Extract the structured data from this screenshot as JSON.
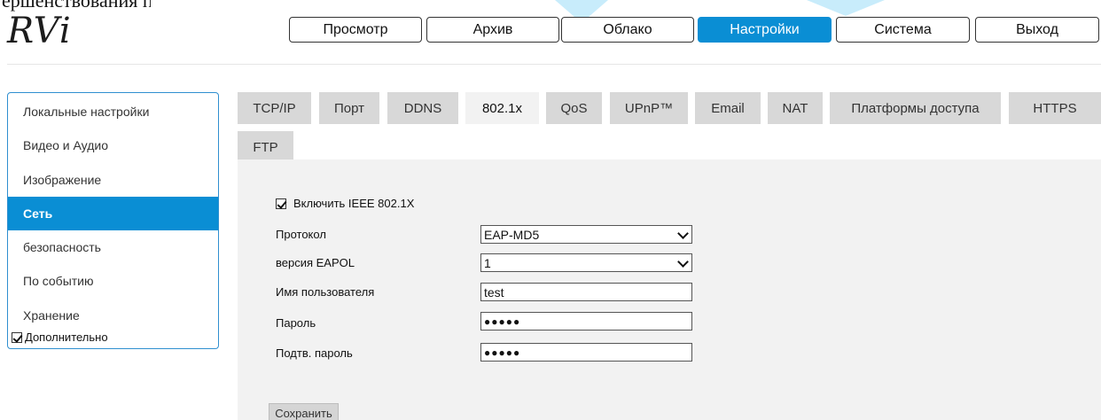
{
  "top_crop_text": "ершенствования программного",
  "logo": {
    "text": "RVi"
  },
  "main_nav": [
    {
      "label": "Просмотр",
      "active": false
    },
    {
      "label": "Архив",
      "active": false
    },
    {
      "label": "Облако",
      "active": false
    },
    {
      "label": "Настройки",
      "active": true
    },
    {
      "label": "Система",
      "active": false
    },
    {
      "label": "Выход",
      "active": false
    }
  ],
  "sidebar": {
    "items": [
      {
        "label": "Локальные настройки",
        "active": false
      },
      {
        "label": "Видео и Аудио",
        "active": false
      },
      {
        "label": "Изображение",
        "active": false
      },
      {
        "label": "Сеть",
        "active": true
      },
      {
        "label": "безопасность",
        "active": false
      },
      {
        "label": "По событию",
        "active": false
      },
      {
        "label": "Хранение",
        "active": false
      }
    ],
    "advanced": {
      "label": "Дополнительно",
      "checked": true
    }
  },
  "tabs": [
    {
      "label": "TCP/IP",
      "active": false
    },
    {
      "label": "Порт",
      "active": false
    },
    {
      "label": "DDNS",
      "active": false
    },
    {
      "label": "802.1x",
      "active": true
    },
    {
      "label": "QoS",
      "active": false
    },
    {
      "label": "UPnP™",
      "active": false
    },
    {
      "label": "Email",
      "active": false
    },
    {
      "label": "NAT",
      "active": false
    },
    {
      "label": "Платформы доступа",
      "active": false
    },
    {
      "label": "HTTPS",
      "active": false
    },
    {
      "label": "FTP",
      "active": false
    }
  ],
  "form": {
    "enable": {
      "label": "Включить IEEE 802.1X",
      "checked": true
    },
    "protocol": {
      "label": "Протокол",
      "value": "EAP-MD5"
    },
    "eapol": {
      "label": "версия EAPOL",
      "value": "1"
    },
    "username": {
      "label": "Имя пользователя",
      "value": "test"
    },
    "password": {
      "label": "Пароль",
      "value": "●●●●●"
    },
    "confirm": {
      "label": "Подтв. пароль",
      "value": "●●●●●"
    },
    "save_label": "Сохранить"
  },
  "colors": {
    "accent": "#0a8ed4",
    "panel_bg": "#f2f2f2",
    "tab_bg": "#d8d8d8"
  }
}
